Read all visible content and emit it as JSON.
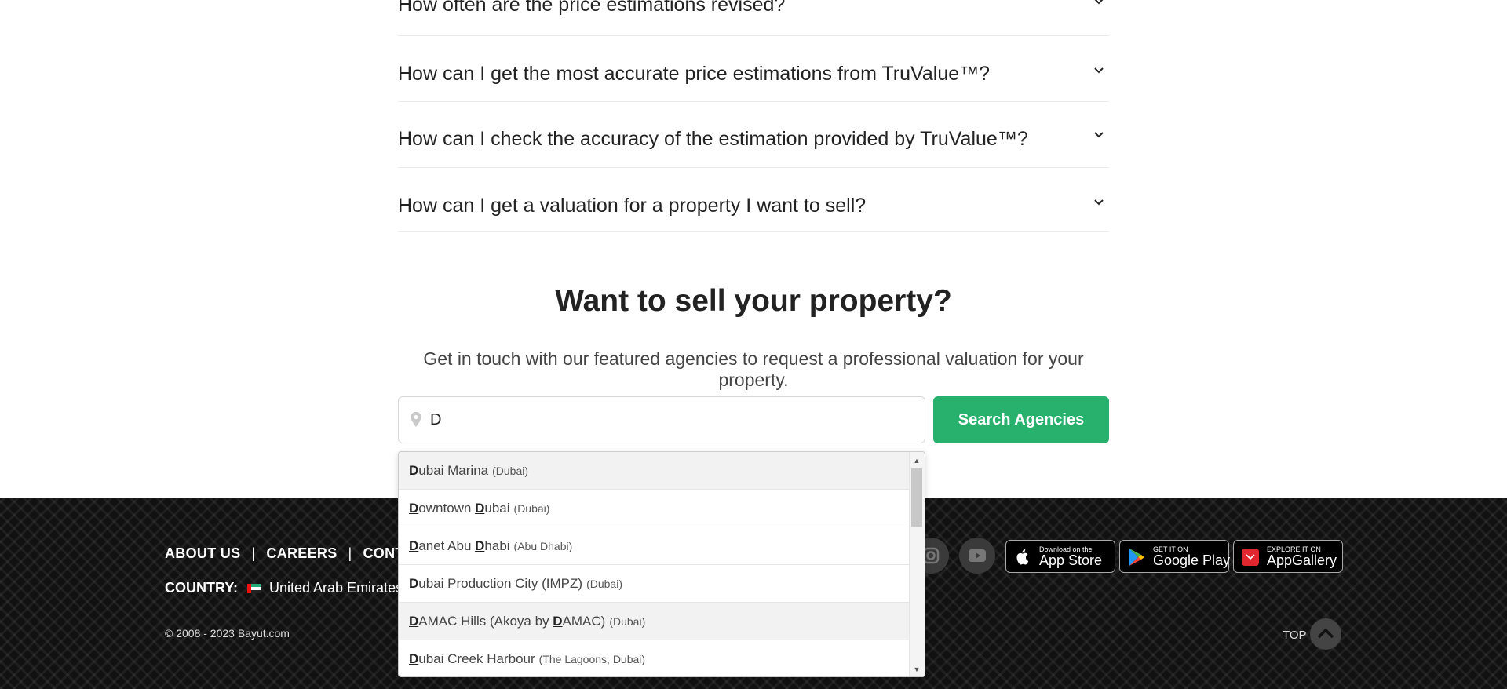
{
  "faq": {
    "items": [
      {
        "question": "How often are the price estimations revised?"
      },
      {
        "question": "How can I get the most accurate price estimations from TruValue™?"
      },
      {
        "question": "How can I check the accuracy of the estimation provided by TruValue™?"
      },
      {
        "question": "How can I get a valuation for a property I want to sell?"
      }
    ]
  },
  "sell": {
    "title": "Want to sell your property?",
    "subtitle": "Get in touch with our featured agencies to request a professional valuation for your property.",
    "search_value": "D",
    "search_button": "Search Agencies"
  },
  "dropdown": {
    "items": [
      {
        "parts": [
          [
            "D",
            true
          ],
          [
            "ubai Marina",
            false
          ]
        ],
        "city": "(Dubai)"
      },
      {
        "parts": [
          [
            "D",
            true
          ],
          [
            "owntown ",
            false
          ],
          [
            "D",
            true
          ],
          [
            "ubai",
            false
          ]
        ],
        "city": "(Dubai)"
      },
      {
        "parts": [
          [
            "D",
            true
          ],
          [
            "anet Abu ",
            false
          ],
          [
            "D",
            true
          ],
          [
            "habi",
            false
          ]
        ],
        "city": "(Abu Dhabi)"
      },
      {
        "parts": [
          [
            "D",
            true
          ],
          [
            "ubai Production City (IMPZ)",
            false
          ]
        ],
        "city": "(Dubai)"
      },
      {
        "parts": [
          [
            "D",
            true
          ],
          [
            "AMAC Hills (Akoya by ",
            false
          ],
          [
            "D",
            true
          ],
          [
            "AMAC)",
            false
          ]
        ],
        "city": "(Dubai)"
      },
      {
        "parts": [
          [
            "D",
            true
          ],
          [
            "ubai Creek Harbour",
            false
          ]
        ],
        "city": "(The Lagoons, Dubai)"
      }
    ],
    "highlighted_index": 0,
    "hover_index": 4
  },
  "footer": {
    "links": [
      "ABOUT US",
      "CAREERS",
      "CONT"
    ],
    "separator": "|",
    "country_label": "COUNTRY:",
    "country_value": "United Arab Emirates",
    "copyright": "© 2008 - 2023 Bayut.com",
    "top_label": "TOP",
    "stores": [
      {
        "small": "Download on the",
        "big": "App Store"
      },
      {
        "small": "GET IT ON",
        "big": "Google Play"
      },
      {
        "small": "EXPLORE IT ON",
        "big": "AppGallery"
      }
    ],
    "social_icons": [
      "instagram-icon",
      "youtube-icon"
    ]
  }
}
